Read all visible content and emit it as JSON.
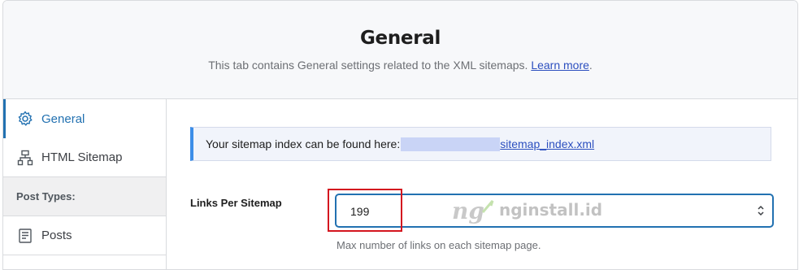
{
  "header": {
    "title": "General",
    "description": "This tab contains General settings related to the XML sitemaps.",
    "learn_more": "Learn more",
    "period": "."
  },
  "sidebar": {
    "items": [
      {
        "label": "General",
        "icon": "gear-icon",
        "active": true
      },
      {
        "label": "HTML Sitemap",
        "icon": "sitemap-icon",
        "active": false
      },
      {
        "label": "Post Types:",
        "section": true
      },
      {
        "label": "Posts",
        "icon": "document-icon",
        "active": false
      }
    ]
  },
  "notice": {
    "text": "Your sitemap index can be found here:",
    "link": "sitemap_index.xml"
  },
  "links_per_sitemap": {
    "label": "Links Per Sitemap",
    "value": "199",
    "help": "Max number of links on each sitemap page."
  },
  "watermark": {
    "text": "nginstall.id"
  },
  "colors": {
    "accent": "#2271b1",
    "highlight": "#d4161f",
    "notice_border": "#3d8ee8"
  }
}
